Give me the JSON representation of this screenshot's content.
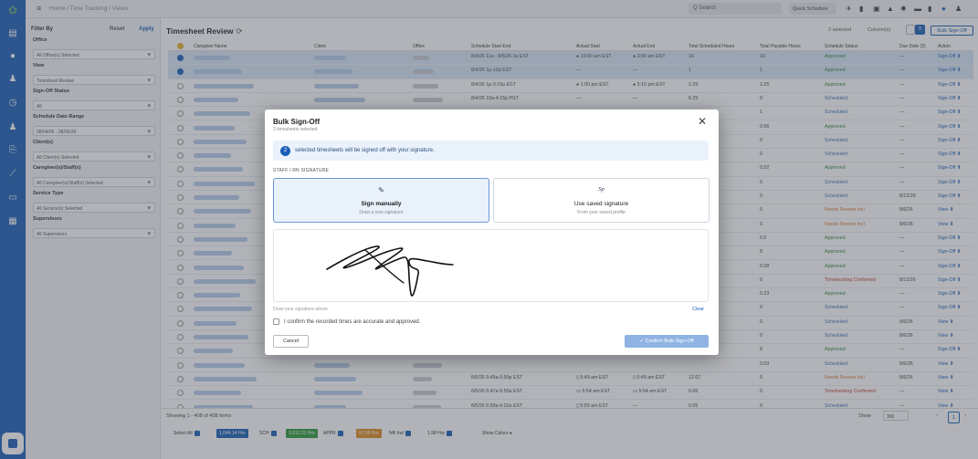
{
  "topbar": {
    "breadcrumb": "Home / Time Tracking / Views",
    "search_placeholder": "Q Search",
    "quick_schedule": "Quick Schedule"
  },
  "filters": {
    "title": "Filter By",
    "reset": "Reset",
    "apply": "Apply",
    "groups": [
      {
        "label": "Office",
        "value": "All Office(s) Selected"
      },
      {
        "label": "View",
        "value": "Timesheet Review"
      },
      {
        "label": "Sign-Off Status",
        "value": "All"
      },
      {
        "label": "Schedule Date Range",
        "value": "08/04/26 - 08/05/26"
      },
      {
        "label": "Client(s)",
        "value": "All Client(s) Selected"
      },
      {
        "label": "Caregiver(s)/Staff(s)",
        "value": "All Caregiver(s)/Staff(s) Selected"
      },
      {
        "label": "Service Type",
        "value": "All Service(s) Selected"
      },
      {
        "label": "Supervisors",
        "value": "All Supervisors"
      }
    ]
  },
  "page": {
    "title": "Timesheet Review",
    "selected_info": "2 selected",
    "columns_label": "Column(s)",
    "bulk_signoff": "Bulk Sign-Off"
  },
  "table": {
    "headers": [
      "Caregiver Name",
      "Client",
      "Office",
      "Schedule Start-End",
      "Actual Start",
      "Actual End",
      "Total Scheduled Hours",
      "Total Payable Hours",
      "Schedule Status",
      "Due Date (3)",
      "Action"
    ],
    "rows": [
      {
        "sel": true,
        "sched": "8/4/26 11a - 8/5/26 3a EST",
        "astart": "● 10:00 am EST",
        "aend": "● 3:00 am EST",
        "tsh": "16",
        "tph": "16",
        "status": "Approved",
        "st": "ok",
        "due": "—",
        "action": "Sign-Off ⬇"
      },
      {
        "sel": true,
        "sched": "8/4/26 1p-12p EST",
        "astart": "—",
        "aend": "—",
        "tsh": "1",
        "tph": "1",
        "status": "Approved",
        "st": "ok",
        "due": "—",
        "action": "Sign-Off ⬇"
      },
      {
        "sel": false,
        "sched": "8/4/26 1p-3:15p EST",
        "astart": "● 1:00 pm EST",
        "aend": "● 3:15 pm EST",
        "tsh": "2.25",
        "tph": "2.25",
        "status": "Approved",
        "st": "ok",
        "due": "—",
        "action": "Sign-Off ⬇"
      },
      {
        "sel": false,
        "sched": "8/4/26 10a-4:15p PST",
        "astart": "—",
        "aend": "—",
        "tsh": "6.25",
        "tph": "0",
        "status": "Scheduled",
        "st": "sc",
        "due": "—",
        "action": "Sign-Off ⬇"
      },
      {
        "sel": false,
        "sched": "",
        "astart": "",
        "aend": "",
        "tsh": "",
        "tph": "1",
        "status": "Scheduled",
        "st": "sc",
        "due": "—",
        "action": "Sign-Off ⬇"
      },
      {
        "sel": false,
        "sched": "",
        "astart": "",
        "aend": "",
        "tsh": "",
        "tph": "0.66",
        "status": "Approved",
        "st": "ok",
        "due": "—",
        "action": "Sign-Off ⬇"
      },
      {
        "sel": false,
        "sched": "",
        "astart": "",
        "aend": "",
        "tsh": "",
        "tph": "0",
        "status": "Scheduled",
        "st": "sc",
        "due": "—",
        "action": "Sign-Off ⬇"
      },
      {
        "sel": false,
        "sched": "",
        "astart": "",
        "aend": "",
        "tsh": "",
        "tph": "0",
        "status": "Scheduled",
        "st": "sc",
        "due": "—",
        "action": "Sign-Off ⬇"
      },
      {
        "sel": false,
        "sched": "",
        "astart": "",
        "aend": "",
        "tsh": "",
        "tph": "0.52",
        "status": "Approved",
        "st": "ok",
        "due": "—",
        "action": "Sign-Off ⬇"
      },
      {
        "sel": false,
        "sched": "",
        "astart": "",
        "aend": "",
        "tsh": "",
        "tph": "0",
        "status": "Scheduled",
        "st": "sc",
        "due": "—",
        "action": "Sign-Off ⬇"
      },
      {
        "sel": false,
        "sched": "",
        "astart": "",
        "aend": "",
        "tsh": "",
        "tph": "0",
        "status": "Scheduled",
        "st": "sc",
        "due": "8/12/26",
        "action": "Sign-Off ⬇"
      },
      {
        "sel": false,
        "sched": "",
        "astart": "",
        "aend": "",
        "tsh": "",
        "tph": "0",
        "status": "Needs Review Incl",
        "st": "nr",
        "due": "8/6/26",
        "action": "View ⬇"
      },
      {
        "sel": false,
        "sched": "",
        "astart": "",
        "aend": "",
        "tsh": "",
        "tph": "0",
        "status": "Needs Review Incl",
        "st": "nr",
        "due": "8/6/26",
        "action": "View ⬇"
      },
      {
        "sel": false,
        "sched": "",
        "astart": "",
        "aend": "",
        "tsh": "",
        "tph": "0.5",
        "status": "Approved",
        "st": "ok",
        "due": "—",
        "action": "Sign-Off ⬇"
      },
      {
        "sel": false,
        "sched": "",
        "astart": "",
        "aend": "",
        "tsh": "",
        "tph": "8",
        "status": "Approved",
        "st": "ok",
        "due": "—",
        "action": "Sign-Off ⬇"
      },
      {
        "sel": false,
        "sched": "",
        "astart": "",
        "aend": "",
        "tsh": "",
        "tph": "0.08",
        "status": "Approved",
        "st": "ok",
        "due": "—",
        "action": "Sign-Off ⬇"
      },
      {
        "sel": false,
        "sched": "",
        "astart": "",
        "aend": "",
        "tsh": "",
        "tph": "0",
        "status": "Timetracking Confirmed",
        "st": "tc",
        "due": "8/12/26",
        "action": "Sign-Off ⬇"
      },
      {
        "sel": false,
        "sched": "",
        "astart": "",
        "aend": "",
        "tsh": "",
        "tph": "0.23",
        "status": "Approved",
        "st": "ok",
        "due": "—",
        "action": "Sign-Off ⬇"
      },
      {
        "sel": false,
        "sched": "",
        "astart": "",
        "aend": "",
        "tsh": "",
        "tph": "0",
        "status": "Scheduled",
        "st": "sc",
        "due": "—",
        "action": "Sign-Off ⬇"
      },
      {
        "sel": false,
        "sched": "",
        "astart": "",
        "aend": "",
        "tsh": "",
        "tph": "0",
        "status": "Scheduled",
        "st": "sc",
        "due": "8/6/26",
        "action": "View ⬇"
      },
      {
        "sel": false,
        "sched": "",
        "astart": "",
        "aend": "",
        "tsh": "",
        "tph": "0",
        "status": "Scheduled",
        "st": "sc",
        "due": "8/6/26",
        "action": "View ⬇"
      },
      {
        "sel": false,
        "sched": "",
        "astart": "",
        "aend": "",
        "tsh": "",
        "tph": "8",
        "status": "Approved",
        "st": "ok",
        "due": "—",
        "action": "Sign-Off ⬇"
      },
      {
        "sel": false,
        "sched": "",
        "astart": "",
        "aend": "",
        "tsh": "",
        "tph": "0.03",
        "status": "Scheduled",
        "st": "sc",
        "due": "8/6/26",
        "action": "View ⬇"
      },
      {
        "sel": false,
        "sched": "8/5/26 5:49a-5:50p EST",
        "astart": "▯ 5:49 am EST",
        "aend": "▯ 5:49 am EST",
        "tsh": "12.07",
        "tph": "0",
        "status": "Needs Review Incl",
        "st": "nr",
        "due": "8/6/26",
        "action": "View ⬇"
      },
      {
        "sel": false,
        "sched": "8/5/26 5:47a-5:50a EST",
        "astart": "▭ 5:54 am EST",
        "aend": "▭ 5:54 am EST",
        "tsh": "0.05",
        "tph": "0",
        "status": "Timetracking Confirmed",
        "st": "tc",
        "due": "—",
        "action": "View ⬇"
      },
      {
        "sel": false,
        "sched": "8/5/26 5:59a-6:02a EST",
        "astart": "▯ 5:59 am EST",
        "aend": "—",
        "tsh": "0.05",
        "tph": "0",
        "status": "Scheduled",
        "st": "sc",
        "due": "—",
        "action": "View ⬇"
      }
    ]
  },
  "footer": {
    "showing": "Showing 1 - 408 of 408 items",
    "show_label": "Show",
    "show_value": "300",
    "page": "1",
    "select_all": "Select All",
    "chips": [
      {
        "label": "1,044.14 Hrs",
        "color": "#1b5fb6",
        "text": "SCH"
      },
      {
        "label": "1,012.31 Hrs",
        "color": "#2e9a3a",
        "text": "APPR"
      },
      {
        "label": "97.88 Hrs",
        "color": "#e08a1e",
        "text": "NR Incl"
      }
    ],
    "extra": "1.98 Hrs",
    "show_colors": "Show Colors"
  },
  "modal": {
    "title": "Bulk Sign-Off",
    "subtitle": "2 timesheets selected",
    "info_count": "2",
    "info_text": "selected timesheets will be signed off with your signature.",
    "section": "STAFF / RN SIGNATURE",
    "opt_manual_title": "Sign manually",
    "opt_manual_sub": "Draw a new signature",
    "opt_saved_title": "Use saved signature",
    "opt_saved_sub": "From your saved profile",
    "saved_icon_text": "Sp",
    "hint": "Draw your signature above",
    "clear": "Clear",
    "confirm": "I confirm the recorded times are accurate and approved.",
    "cancel": "Cancel",
    "confirm_btn": "✓ Confirm Bulk Sign-Off"
  }
}
